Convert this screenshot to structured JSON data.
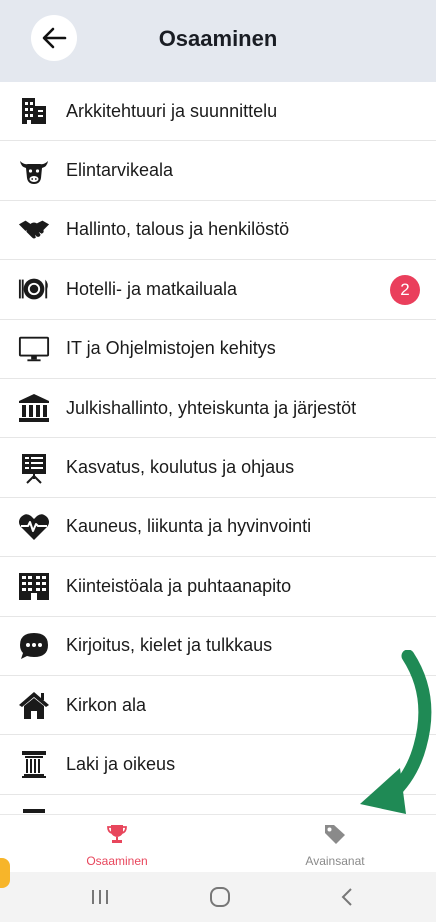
{
  "header": {
    "title": "Osaaminen"
  },
  "list": {
    "items": [
      {
        "label": "Arkkitehtuuri ja suunnittelu",
        "icon": "building-icon"
      },
      {
        "label": "Elintarvikeala",
        "icon": "cow-icon"
      },
      {
        "label": "Hallinto, talous ja henkilöstö",
        "icon": "handshake-icon"
      },
      {
        "label": "Hotelli- ja matkailuala",
        "icon": "plate-cutlery-icon",
        "badge": "2"
      },
      {
        "label": "IT ja Ohjelmistojen kehitys",
        "icon": "monitor-icon"
      },
      {
        "label": "Julkishallinto, yhteiskunta ja järjestöt",
        "icon": "institution-icon"
      },
      {
        "label": "Kasvatus, koulutus ja ohjaus",
        "icon": "presentation-board-icon"
      },
      {
        "label": "Kauneus, liikunta ja hyvinvointi",
        "icon": "heartbeat-icon"
      },
      {
        "label": "Kiinteistöala ja puhtaanapito",
        "icon": "office-building-icon"
      },
      {
        "label": "Kirjoitus, kielet ja tulkkaus",
        "icon": "chat-bubble-icon"
      },
      {
        "label": "Kirkon ala",
        "icon": "house-icon"
      },
      {
        "label": "Laki ja oikeus",
        "icon": "column-icon"
      }
    ]
  },
  "bottom_nav": {
    "items": [
      {
        "label": "Osaaminen",
        "icon": "trophy-icon",
        "active": true
      },
      {
        "label": "Avainsanat",
        "icon": "tag-icon",
        "active": false
      }
    ]
  },
  "colors": {
    "accent": "#e8465c",
    "header_bg": "#e4e8ef",
    "inactive": "#8a8a8a",
    "arrow": "#1f8a55"
  }
}
